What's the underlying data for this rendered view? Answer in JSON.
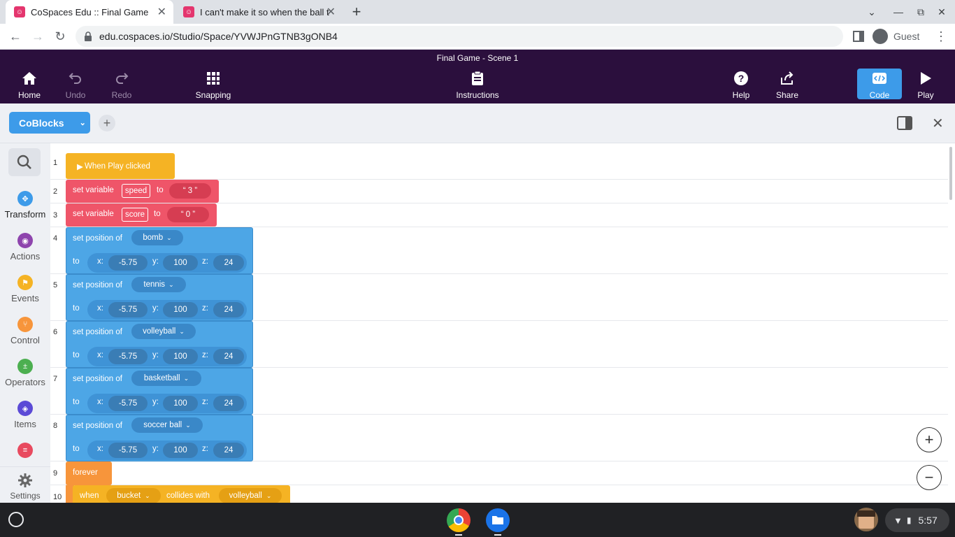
{
  "browser": {
    "tabs": [
      {
        "title": "CoSpaces Edu :: Final Game",
        "active": true
      },
      {
        "title": "I can't make it so when the ball t",
        "active": false
      }
    ],
    "url": "edu.cospaces.io/Studio/Space/YVWJPnGTNB3gONB4",
    "profile_label": "Guest"
  },
  "app": {
    "scene_title": "Final Game - Scene 1",
    "toolbar": {
      "home": "Home",
      "undo": "Undo",
      "redo": "Redo",
      "snapping": "Snapping",
      "instructions": "Instructions",
      "help": "Help",
      "share": "Share",
      "code": "Code",
      "play": "Play"
    },
    "editor_tab": "CoBlocks",
    "categories": [
      {
        "label": "Transform",
        "color": "#3d9be9",
        "icon": "move-icon"
      },
      {
        "label": "Actions",
        "color": "#8e44ad",
        "icon": "eye-icon"
      },
      {
        "label": "Events",
        "color": "#f5b324",
        "icon": "flag-icon"
      },
      {
        "label": "Control",
        "color": "#f7953b",
        "icon": "branch-icon"
      },
      {
        "label": "Operators",
        "color": "#4caf50",
        "icon": "plus-percent-icon"
      },
      {
        "label": "Items",
        "color": "#5b4ad6",
        "icon": "cube-icon"
      }
    ],
    "settings": "Settings"
  },
  "code": {
    "line_numbers": [
      "1",
      "2",
      "3",
      "4",
      "5",
      "6",
      "7",
      "8",
      "9",
      "10"
    ],
    "when_play": "When Play clicked",
    "set_variable_label": "set variable",
    "to_label": "to",
    "variables": [
      {
        "name": "speed",
        "value": "“ 3 ”"
      },
      {
        "name": "score",
        "value": "“ 0 ”"
      }
    ],
    "set_position_label": "set position of",
    "axis": {
      "x": "x:",
      "y": "y:",
      "z": "z:"
    },
    "positions": [
      {
        "item": "bomb",
        "x": "-5.75",
        "y": "100",
        "z": "24"
      },
      {
        "item": "tennis",
        "x": "-5.75",
        "y": "100",
        "z": "24"
      },
      {
        "item": "volleyball",
        "x": "-5.75",
        "y": "100",
        "z": "24"
      },
      {
        "item": "basketball",
        "x": "-5.75",
        "y": "100",
        "z": "24"
      },
      {
        "item": "soccer ball",
        "x": "-5.75",
        "y": "100",
        "z": "24"
      }
    ],
    "forever": "forever",
    "when_label": "when",
    "collides_label": "collides with",
    "collide_a": "bucket",
    "collide_b": "volleyball"
  },
  "taskbar": {
    "time": "5:57"
  }
}
